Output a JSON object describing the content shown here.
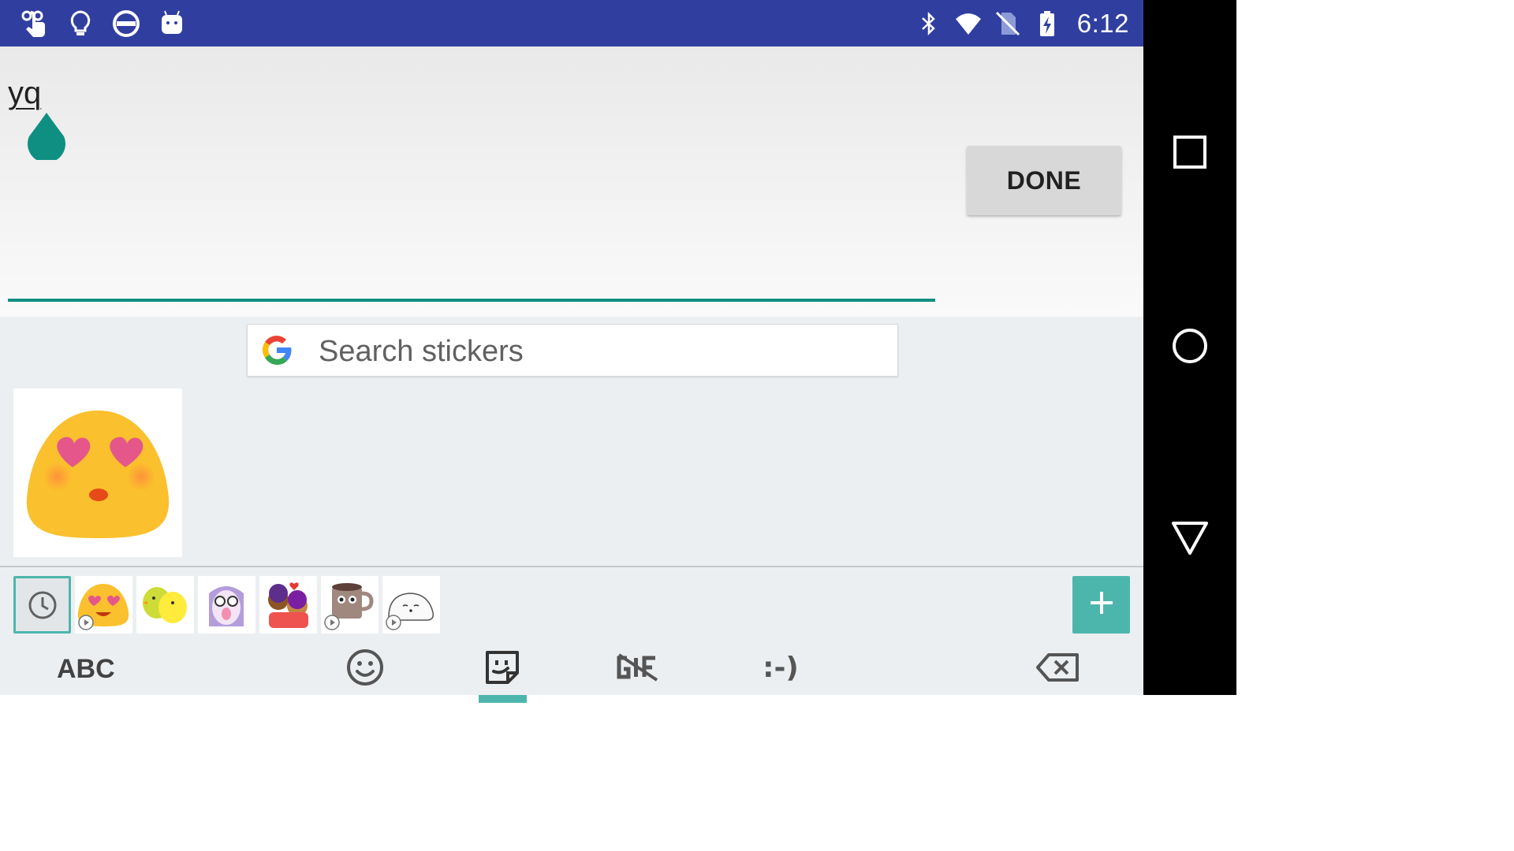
{
  "status_bar": {
    "time": "6:12",
    "left_icons": [
      "touch-icon",
      "lightbulb-icon",
      "do-not-disturb-icon",
      "android-icon"
    ],
    "right_icons": [
      "bluetooth-icon",
      "wifi-icon",
      "no-sim-icon",
      "battery-charging-icon"
    ],
    "background": "#303f9f"
  },
  "edit_area": {
    "text": "yq",
    "done_label": "DONE",
    "accent": "#0f8f82"
  },
  "keyboard": {
    "search_placeholder": "Search stickers",
    "results": [
      "heart-eyes-blob-sticker"
    ],
    "packs": [
      "recent-icon",
      "blob-emoji-pack",
      "chick-pack",
      "owl-pack",
      "couple-pack",
      "coffee-cup-pack",
      "seal-pack"
    ],
    "accent": "#4db6ac"
  },
  "bottom_bar": {
    "abc_label": "ABC",
    "emoticon_label": ":-)",
    "tabs": [
      "smiley-icon",
      "sticker-icon",
      "gif-icon",
      "emoticon-tab",
      "backspace-icon"
    ]
  },
  "nav_bar": [
    "recents-square-icon",
    "home-circle-icon",
    "back-triangle-icon"
  ]
}
